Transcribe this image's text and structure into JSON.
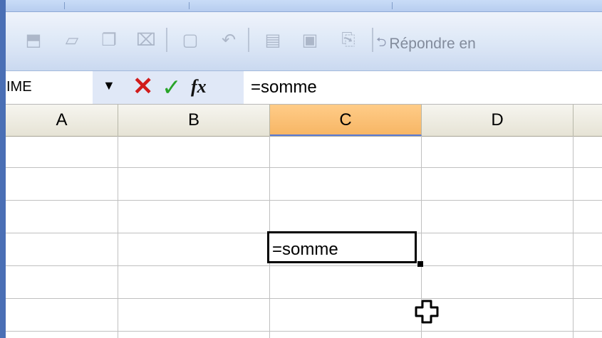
{
  "toolbar": {
    "reply_label": "Répondre en",
    "icons": [
      "open-icon",
      "edit-icon",
      "copy-icon",
      "delete-icon",
      "paste-icon",
      "undo-icon",
      "clipboard-icon",
      "save-icon",
      "attach-icon"
    ]
  },
  "formula_bar": {
    "name_box": "IME",
    "formula": "=somme"
  },
  "columns": [
    "A",
    "B",
    "C",
    "D"
  ],
  "selected_column": "C",
  "active_cell": {
    "column": "C",
    "value": "=somme"
  },
  "colors": {
    "selected_header": "#f7b665",
    "cancel": "#d11b1b",
    "enter": "#28a428",
    "formula_panel": "#e0e8f7"
  }
}
